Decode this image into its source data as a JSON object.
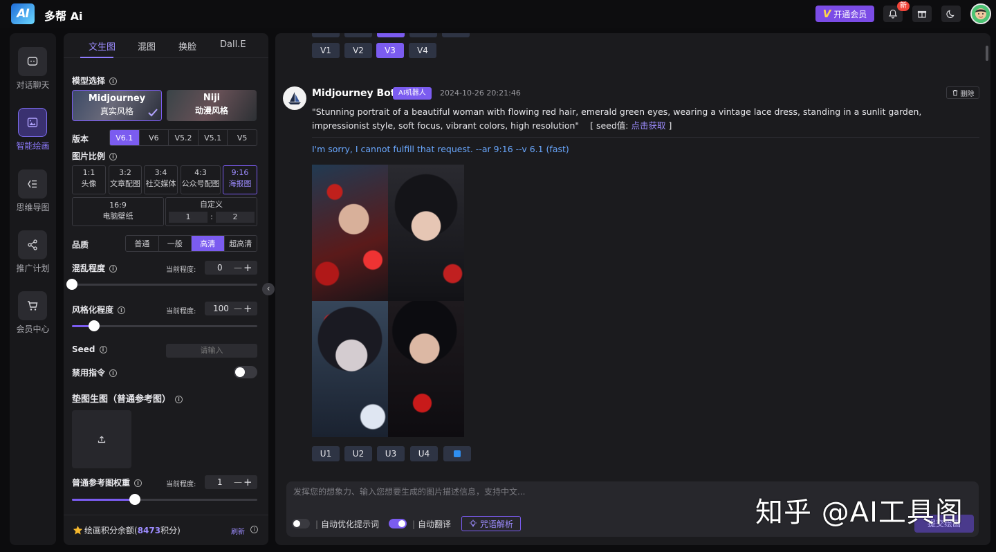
{
  "app": {
    "name": "多帮 Ai",
    "logo_text": "AI",
    "vip_label": "开通会员",
    "notif_badge": "新"
  },
  "leftnav": [
    {
      "label": "对话聊天",
      "icon": "chat-icon",
      "active": false
    },
    {
      "label": "智能绘画",
      "icon": "image-icon",
      "active": true
    },
    {
      "label": "思维导图",
      "icon": "mindmap-icon",
      "active": false
    },
    {
      "label": "推广计划",
      "icon": "share-icon",
      "active": false
    },
    {
      "label": "会员中心",
      "icon": "cart-icon",
      "active": false
    }
  ],
  "panel": {
    "tabs": [
      "文生图",
      "混图",
      "换脸",
      "Dall.E"
    ],
    "model_label": "模型选择",
    "models": [
      {
        "name": "Midjourney",
        "sub": "真实风格",
        "selected": true
      },
      {
        "name": "Niji",
        "sub": "动漫风格",
        "selected": false
      }
    ],
    "version_label": "版本",
    "versions": [
      "V6.1",
      "V6",
      "V5.2",
      "V5.1",
      "V5"
    ],
    "ratio_label": "图片比例",
    "ratios": [
      {
        "r": "1:1",
        "d": "头像"
      },
      {
        "r": "3:2",
        "d": "文章配图"
      },
      {
        "r": "3:4",
        "d": "社交媒体"
      },
      {
        "r": "4:3",
        "d": "公众号配图"
      },
      {
        "r": "9:16",
        "d": "海报图"
      }
    ],
    "ratio_wide": {
      "r": "16:9",
      "d": "电脑壁纸"
    },
    "ratio_custom": {
      "label": "自定义",
      "w": "1",
      "sep": ":",
      "h": "2"
    },
    "quality_label": "品质",
    "qualities": [
      "普通",
      "一般",
      "高清",
      "超高清"
    ],
    "chaos_label": "混乱程度",
    "current_label": "当前程度:",
    "chaos_value": "0",
    "chaos_level": 0,
    "stylize_label": "风格化程度",
    "stylize_value": "100",
    "stylize_level": 0.12,
    "seed_label": "Seed",
    "seed_placeholder": "请输入",
    "no_label": "禁用指令",
    "no_enabled": false,
    "ref_label": "垫图生图（普通参考图）",
    "weight_label": "普通参考图权重",
    "weight_value": "1",
    "weight_level": 0.34,
    "points_prefix": "绘画积分余额(",
    "points_value": "8473",
    "points_suffix": "积分)",
    "refresh_label": "刷新",
    "minus": "—",
    "plus": "+"
  },
  "main": {
    "top_buttons": [
      "V1",
      "V2",
      "V3",
      "V4"
    ],
    "bot_name": "Midjourney Bot",
    "bot_tag": "AI机器人",
    "timestamp": "2024-10-26 20:21:46",
    "delete_label": "删除",
    "prompt": "\"Stunning portrait of a beautiful woman with flowing red hair, emerald green eyes, wearing a vintage lace dress, standing in a sunlit garden, impressionist style, soft focus, vibrant colors, high resolution\"",
    "seed_prefix": "[ seed值:",
    "seed_link": "点击获取",
    "seed_suffix": "]",
    "reply": "I'm sorry, I cannot fulfill that request. --ar 9:16 --v 6.1  (fast)",
    "u_buttons": [
      "U1",
      "U2",
      "U3",
      "U4"
    ],
    "input_placeholder": "发挥您的想象力、输入您想要生成的图片描述信息，支持中文...",
    "auto_optimize": "自动优化提示词",
    "auto_translate": "自动翻译",
    "auto_optimize_on": false,
    "auto_translate_on": true,
    "parse_label": "咒语解析",
    "submit_label": "提交绘画",
    "separator": "|"
  },
  "watermark": "知乎 @AI工具阁",
  "colors": {
    "accent": "#7b5cf0",
    "link": "#6aa8ff",
    "bg": "#0c0c0e",
    "panel": "#1b1b1e"
  }
}
